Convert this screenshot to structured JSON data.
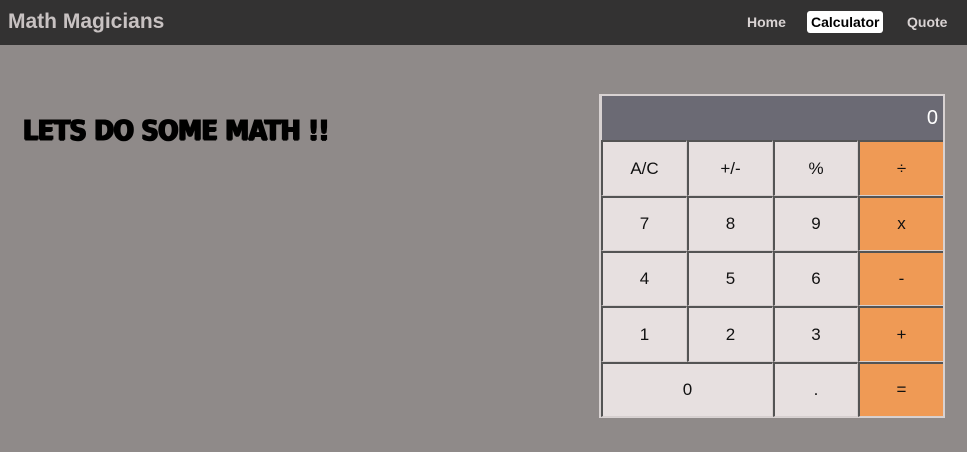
{
  "navbar": {
    "brand": "Math Magicians",
    "links": [
      {
        "label": "Home",
        "active": false
      },
      {
        "label": "Calculator",
        "active": true
      },
      {
        "label": "Quote",
        "active": false
      }
    ]
  },
  "main": {
    "headline": "LETS DO SOME MATH !!"
  },
  "calculator": {
    "display": "0",
    "rows": [
      [
        "A/C",
        "+/-",
        "%",
        "÷"
      ],
      [
        "7",
        "8",
        "9",
        "x"
      ],
      [
        "4",
        "5",
        "6",
        "-"
      ],
      [
        "1",
        "2",
        "3",
        "+"
      ],
      [
        "0",
        ".",
        "="
      ]
    ]
  },
  "colors": {
    "page_background": "#8f8a89",
    "navbar_background": "#333232",
    "display_background": "#6b6a74",
    "key_background": "#e7e0e0",
    "operator_background": "#ef9a55"
  }
}
